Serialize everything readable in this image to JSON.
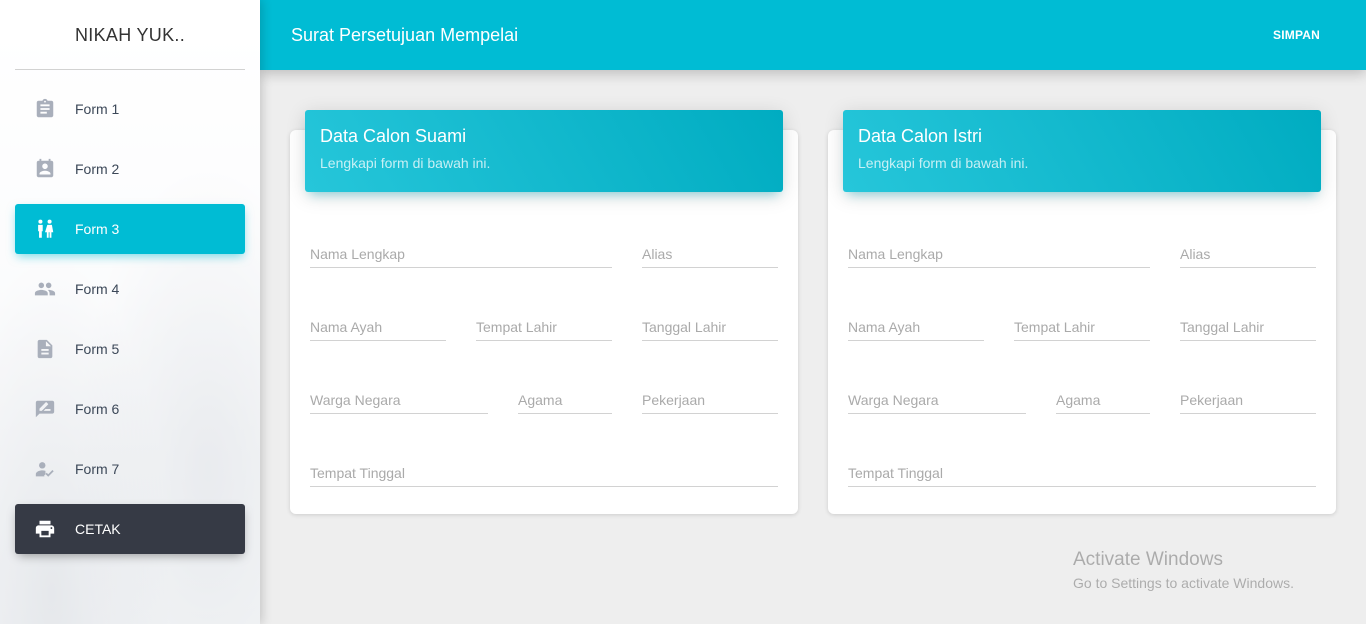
{
  "sidebar": {
    "brand": "NIKAH YUK..",
    "items": [
      {
        "label": "Form 1",
        "icon": "clipboard-icon"
      },
      {
        "label": "Form 2",
        "icon": "contact-calendar-icon"
      },
      {
        "label": "Form 3",
        "icon": "couple-icon"
      },
      {
        "label": "Form 4",
        "icon": "people-icon"
      },
      {
        "label": "Form 5",
        "icon": "document-icon"
      },
      {
        "label": "Form 6",
        "icon": "signature-icon"
      },
      {
        "label": "Form 7",
        "icon": "user-check-icon"
      }
    ],
    "active_index": 2,
    "print": {
      "label": "CETAK",
      "icon": "printer-icon"
    }
  },
  "header": {
    "title": "Surat Persetujuan Mempelai",
    "save_label": "SIMPAN"
  },
  "cards": [
    {
      "title": "Data Calon Suami",
      "subtitle": "Lengkapi form di bawah ini.",
      "fields": {
        "nama_lengkap": "Nama Lengkap",
        "alias": "Alias",
        "nama_ayah": "Nama Ayah",
        "tempat_lahir": "Tempat Lahir",
        "tanggal_lahir": "Tanggal Lahir",
        "warga_negara": "Warga Negara",
        "agama": "Agama",
        "pekerjaan": "Pekerjaan",
        "tempat_tinggal": "Tempat Tinggal"
      }
    },
    {
      "title": "Data Calon Istri",
      "subtitle": "Lengkapi form di bawah ini.",
      "fields": {
        "nama_lengkap": "Nama Lengkap",
        "alias": "Alias",
        "nama_ayah": "Nama Ayah",
        "tempat_lahir": "Tempat Lahir",
        "tanggal_lahir": "Tanggal Lahir",
        "warga_negara": "Warga Negara",
        "agama": "Agama",
        "pekerjaan": "Pekerjaan",
        "tempat_tinggal": "Tempat Tinggal"
      }
    }
  ],
  "watermark": {
    "title": "Activate Windows",
    "subtitle": "Go to Settings to activate Windows."
  },
  "colors": {
    "accent": "#00bcd4",
    "dark_button": "#363a45",
    "icon_grey": "#a9afbb"
  }
}
